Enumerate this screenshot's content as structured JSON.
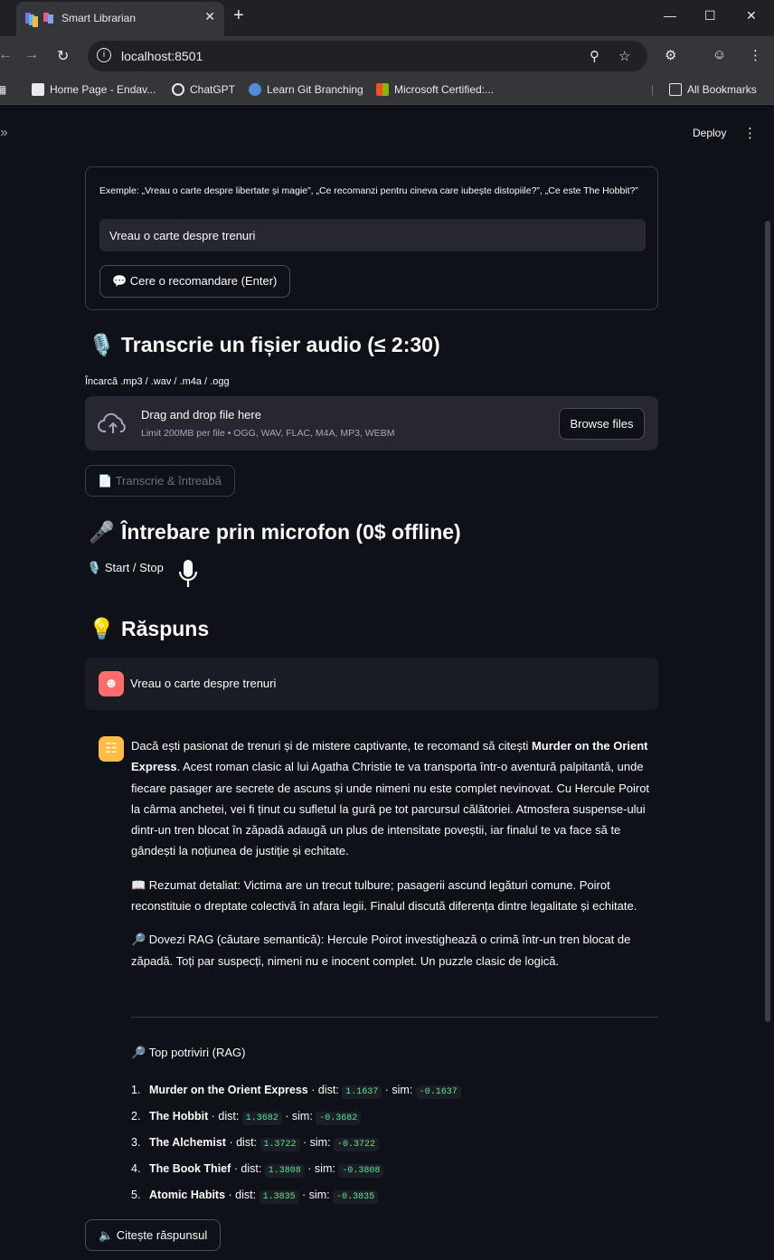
{
  "browser": {
    "tab_title": "Smart Librarian",
    "tab_close": "✕",
    "new_tab": "+",
    "url": "localhost:8501",
    "bookmarks": [
      {
        "label": "Home Page - Endav..."
      },
      {
        "label": "ChatGPT"
      },
      {
        "label": "Learn Git Branching"
      },
      {
        "label": "Microsoft Certified:..."
      }
    ],
    "all_bookmarks": "All Bookmarks"
  },
  "app_header": {
    "deploy": "Deploy"
  },
  "form": {
    "examples": "Exemple: „Vreau o carte despre libertate și magie”, „Ce recomanzi pentru cineva care iubește distopiile?”, „Ce este The Hobbit?”",
    "query_value": "Vreau o carte despre trenuri",
    "submit_label": "💬 Cere o recomandare (Enter)"
  },
  "audio": {
    "title": "Transcrie un fișier audio (≤ 2:30)",
    "upload_label": "Încarcă .mp3 / .wav / .m4a / .ogg",
    "dropzone_main": "Drag and drop file here",
    "dropzone_sub": "Limit 200MB per file • OGG, WAV, FLAC, M4A, MP3, WEBM",
    "browse_label": "Browse files",
    "transcribe_label": "📄 Transcrie & întreabă"
  },
  "mic": {
    "title": "Întrebare prin microfon (0$ offline)",
    "start_stop": "Start / Stop"
  },
  "answer": {
    "title": "Răspuns",
    "user_message": "Vreau o carte despre trenuri",
    "intro_pre": "Dacă ești pasionat de trenuri și de mistere captivante, te recomand să citești ",
    "intro_book": "Murder on the Orient Express",
    "intro_post": ". Acest roman clasic al lui Agatha Christie te va transporta într-o aventură palpitantă, unde fiecare pasager are secrete de ascuns și unde nimeni nu este complet nevinovat. Cu Hercule Poirot la cârma anchetei, vei fi ținut cu sufletul la gură pe tot parcursul călătoriei. Atmosfera suspense-ului dintr-un tren blocat în zăpadă adaugă un plus de intensitate poveștii, iar finalul te va face să te gândești la noțiunea de justiție și echitate.",
    "summary": "📖 Rezumat detaliat: Victima are un trecut tulbure; pasagerii ascund legături comune. Poirot reconstituie o dreptate colectivă în afara legii. Finalul discută diferența dintre legalitate și echitate.",
    "rag_evidence": "🔎 Dovezi RAG (căutare semantică): Hercule Poirot investighează o crimă într-un tren blocat de zăpadă. Toți par suspecți, nimeni nu e inocent complet. Un puzzle clasic de logică.",
    "top_title": "🔎 Top potriviri (RAG)",
    "matches": [
      {
        "num": "1.",
        "title": "Murder on the Orient Express",
        "dist": "1.1637",
        "sim": "-0.1637"
      },
      {
        "num": "2.",
        "title": "The Hobbit",
        "dist": "1.3682",
        "sim": "-0.3682"
      },
      {
        "num": "3.",
        "title": "The Alchemist",
        "dist": "1.3722",
        "sim": "-0.3722"
      },
      {
        "num": "4.",
        "title": "The Book Thief",
        "dist": "1.3808",
        "sim": "-0.3808"
      },
      {
        "num": "5.",
        "title": "Atomic Habits",
        "dist": "1.3835",
        "sim": "-0.3835"
      }
    ],
    "dist_label": " · dist: ",
    "sim_label": " · sim: ",
    "read_label": "🔈 Citește răspunsul"
  }
}
